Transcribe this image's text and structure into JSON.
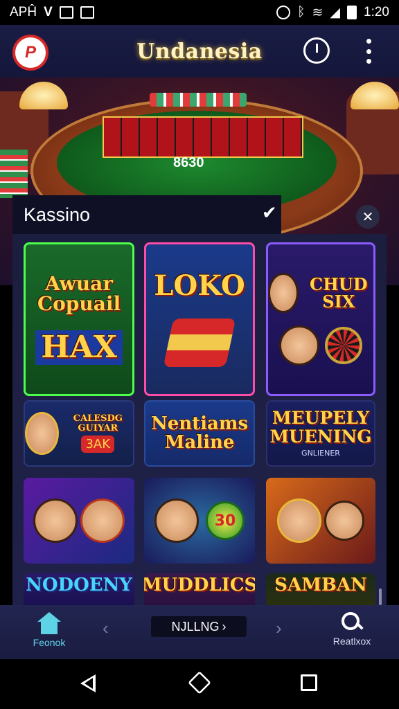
{
  "status_bar": {
    "left_text": "APĤ",
    "time": "1:20",
    "icons": [
      "v-logo-icon",
      "image-icon",
      "screenshot-icon",
      "alarm-icon",
      "bluetooth-icon",
      "wifi-icon",
      "signal-icon",
      "battery-icon"
    ]
  },
  "header": {
    "logo_text": "P",
    "title": "Undanesia",
    "icons": [
      "compass-icon",
      "more-icon"
    ]
  },
  "banner": {
    "table_number": "8630"
  },
  "panel": {
    "title": "Kassino"
  },
  "tiles": [
    {
      "line1": "Awuar Copuail",
      "line2": "HAX"
    },
    {
      "line1": "LOKO"
    },
    {
      "line1": "CHUD SIX"
    },
    {
      "line1": "CALESDG GUIYAR",
      "badge": "3AK"
    },
    {
      "line1": "Nentiams Maline"
    },
    {
      "line1": "MEUPELY MUENING",
      "sub": "GNLIENER"
    },
    {
      "label": ""
    },
    {
      "coin": "30"
    },
    {
      "label": ""
    },
    {
      "line1": "NODOENY"
    },
    {
      "line1": "MUDDLICS"
    },
    {
      "line1": "SAMBAN"
    }
  ],
  "bottom_nav": {
    "home_label": "Feonok",
    "pill_label": "NJLLNG",
    "search_label": "Reatlxox"
  }
}
